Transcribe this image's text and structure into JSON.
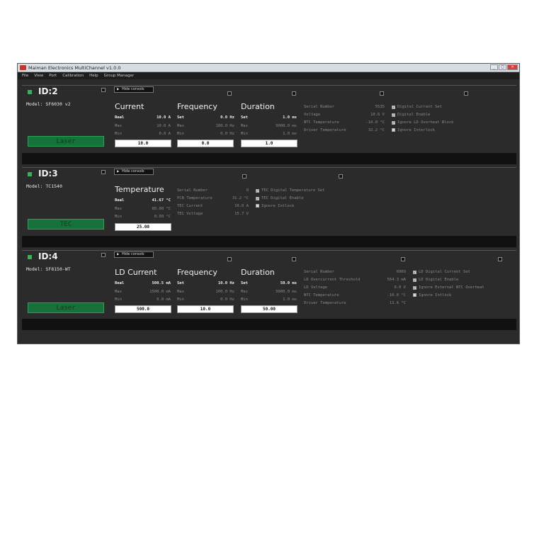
{
  "window": {
    "title": "Maiman Electronics MultiChannel v1.0.0",
    "controls": [
      "_",
      "□",
      "×"
    ]
  },
  "menu": [
    "File",
    "View",
    "Port",
    "Calibration",
    "Help",
    "Group Manager"
  ],
  "devices": [
    {
      "id": "ID:2",
      "model": "Model: SF6030 v2",
      "mode_label": "Laser",
      "hide_label": "Hide consols",
      "sections": [
        {
          "title": "Current",
          "rows": [
            {
              "label": "Real",
              "value": "10.0 A"
            },
            {
              "label": "Max",
              "value": "10.0 A"
            },
            {
              "label": "Min",
              "value": "0.0 A"
            }
          ],
          "entry": "10.0"
        },
        {
          "title": "Frequency",
          "rows": [
            {
              "label": "Set",
              "value": "0.0 Hz"
            },
            {
              "label": "Max",
              "value": "100.0 Hz"
            },
            {
              "label": "Min",
              "value": "0.0 Hz"
            }
          ],
          "entry": "0.0"
        },
        {
          "title": "Duration",
          "rows": [
            {
              "label": "Set",
              "value": "1.0 ms"
            },
            {
              "label": "Max",
              "value": "5000.0 ms"
            },
            {
              "label": "Min",
              "value": "1.0 ms"
            }
          ],
          "entry": "1.0"
        }
      ],
      "info": [
        {
          "label": "Serial Number",
          "value": "5535"
        },
        {
          "label": "Voltage",
          "value": "10.6  V"
        },
        {
          "label": "NTC Temperature",
          "value": "-10.0 °C"
        },
        {
          "label": "Driver Temperature",
          "value": "32.2 °C"
        }
      ],
      "checks": [
        {
          "label": "Digital Current Set",
          "checked": true
        },
        {
          "label": "Digital Enable",
          "checked": true
        },
        {
          "label": "Ignore LD Overheat Block",
          "checked": true
        },
        {
          "label": "Ignore Interlock",
          "checked": false
        }
      ]
    },
    {
      "id": "ID:3",
      "model": "Model: TC1540",
      "mode_label": "TEC",
      "hide_label": "Hide consols",
      "sections": [
        {
          "title": "Temperature",
          "rows": [
            {
              "label": "Real",
              "value": "41.67 °C"
            },
            {
              "label": "Max",
              "value": "80.00 °C"
            },
            {
              "label": "Min",
              "value": "0.00 °C"
            }
          ],
          "entry": "25.00"
        }
      ],
      "info": [
        {
          "label": "Serial Number",
          "value": "0"
        },
        {
          "label": "PCB Temperature",
          "value": "31.2 °C"
        },
        {
          "label": "TEC Current",
          "value": "10.0  A"
        },
        {
          "label": "TEC Voltage",
          "value": "15.7  V"
        }
      ],
      "checks": [
        {
          "label": "TEC Digital Temperature Set",
          "checked": true
        },
        {
          "label": "TEC Digital Enable",
          "checked": true
        },
        {
          "label": "Ignore Intlock",
          "checked": false
        }
      ]
    },
    {
      "id": "ID:4",
      "model": "Model: SF8150-WT",
      "mode_label": "Laser",
      "hide_label": "Hide consols",
      "sections": [
        {
          "title": "LD Current",
          "rows": [
            {
              "label": "Real",
              "value": "500.5 mA"
            },
            {
              "label": "Max",
              "value": "1500.0 mA"
            },
            {
              "label": "Min",
              "value": "0.0 mA"
            }
          ],
          "entry": "500.0"
        },
        {
          "title": "Frequency",
          "rows": [
            {
              "label": "Set",
              "value": "10.0 Hz"
            },
            {
              "label": "Max",
              "value": "100.0 Hz"
            },
            {
              "label": "Min",
              "value": "0.0 Hz"
            }
          ],
          "entry": "10.0"
        },
        {
          "title": "Duration",
          "rows": [
            {
              "label": "Set",
              "value": "50.0 ms"
            },
            {
              "label": "Max",
              "value": "5000.0 ms"
            },
            {
              "label": "Min",
              "value": "1.0 ms"
            }
          ],
          "entry": "50.00"
        }
      ],
      "info": [
        {
          "label": "Serial Number",
          "value": "6969"
        },
        {
          "label": "LD Overcurrent Threshold",
          "value": "564.3 mA"
        },
        {
          "label": "LD Voltage",
          "value": "0.0  V"
        },
        {
          "label": "NTC Temperature",
          "value": "-10.0 °C"
        },
        {
          "label": "Driver Temperature",
          "value": "13.6 °C"
        }
      ],
      "checks": [
        {
          "label": "LD Digital Current Set",
          "checked": true
        },
        {
          "label": "LD Digital Enable",
          "checked": true
        },
        {
          "label": "Ignore External NTC Overheat",
          "checked": true
        },
        {
          "label": "Ignore Intlock",
          "checked": false
        }
      ]
    }
  ]
}
